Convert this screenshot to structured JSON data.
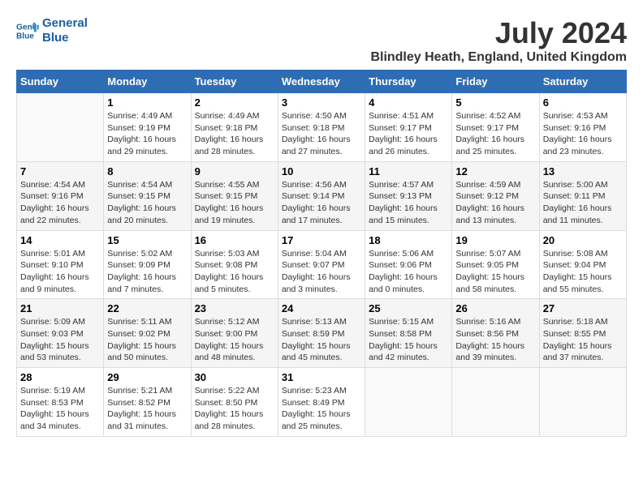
{
  "header": {
    "logo_line1": "General",
    "logo_line2": "Blue",
    "month_title": "July 2024",
    "location": "Blindley Heath, England, United Kingdom"
  },
  "weekdays": [
    "Sunday",
    "Monday",
    "Tuesday",
    "Wednesday",
    "Thursday",
    "Friday",
    "Saturday"
  ],
  "weeks": [
    [
      {
        "day": "",
        "info": ""
      },
      {
        "day": "1",
        "info": "Sunrise: 4:49 AM\nSunset: 9:19 PM\nDaylight: 16 hours\nand 29 minutes."
      },
      {
        "day": "2",
        "info": "Sunrise: 4:49 AM\nSunset: 9:18 PM\nDaylight: 16 hours\nand 28 minutes."
      },
      {
        "day": "3",
        "info": "Sunrise: 4:50 AM\nSunset: 9:18 PM\nDaylight: 16 hours\nand 27 minutes."
      },
      {
        "day": "4",
        "info": "Sunrise: 4:51 AM\nSunset: 9:17 PM\nDaylight: 16 hours\nand 26 minutes."
      },
      {
        "day": "5",
        "info": "Sunrise: 4:52 AM\nSunset: 9:17 PM\nDaylight: 16 hours\nand 25 minutes."
      },
      {
        "day": "6",
        "info": "Sunrise: 4:53 AM\nSunset: 9:16 PM\nDaylight: 16 hours\nand 23 minutes."
      }
    ],
    [
      {
        "day": "7",
        "info": "Sunrise: 4:54 AM\nSunset: 9:16 PM\nDaylight: 16 hours\nand 22 minutes."
      },
      {
        "day": "8",
        "info": "Sunrise: 4:54 AM\nSunset: 9:15 PM\nDaylight: 16 hours\nand 20 minutes."
      },
      {
        "day": "9",
        "info": "Sunrise: 4:55 AM\nSunset: 9:15 PM\nDaylight: 16 hours\nand 19 minutes."
      },
      {
        "day": "10",
        "info": "Sunrise: 4:56 AM\nSunset: 9:14 PM\nDaylight: 16 hours\nand 17 minutes."
      },
      {
        "day": "11",
        "info": "Sunrise: 4:57 AM\nSunset: 9:13 PM\nDaylight: 16 hours\nand 15 minutes."
      },
      {
        "day": "12",
        "info": "Sunrise: 4:59 AM\nSunset: 9:12 PM\nDaylight: 16 hours\nand 13 minutes."
      },
      {
        "day": "13",
        "info": "Sunrise: 5:00 AM\nSunset: 9:11 PM\nDaylight: 16 hours\nand 11 minutes."
      }
    ],
    [
      {
        "day": "14",
        "info": "Sunrise: 5:01 AM\nSunset: 9:10 PM\nDaylight: 16 hours\nand 9 minutes."
      },
      {
        "day": "15",
        "info": "Sunrise: 5:02 AM\nSunset: 9:09 PM\nDaylight: 16 hours\nand 7 minutes."
      },
      {
        "day": "16",
        "info": "Sunrise: 5:03 AM\nSunset: 9:08 PM\nDaylight: 16 hours\nand 5 minutes."
      },
      {
        "day": "17",
        "info": "Sunrise: 5:04 AM\nSunset: 9:07 PM\nDaylight: 16 hours\nand 3 minutes."
      },
      {
        "day": "18",
        "info": "Sunrise: 5:06 AM\nSunset: 9:06 PM\nDaylight: 16 hours\nand 0 minutes."
      },
      {
        "day": "19",
        "info": "Sunrise: 5:07 AM\nSunset: 9:05 PM\nDaylight: 15 hours\nand 58 minutes."
      },
      {
        "day": "20",
        "info": "Sunrise: 5:08 AM\nSunset: 9:04 PM\nDaylight: 15 hours\nand 55 minutes."
      }
    ],
    [
      {
        "day": "21",
        "info": "Sunrise: 5:09 AM\nSunset: 9:03 PM\nDaylight: 15 hours\nand 53 minutes."
      },
      {
        "day": "22",
        "info": "Sunrise: 5:11 AM\nSunset: 9:02 PM\nDaylight: 15 hours\nand 50 minutes."
      },
      {
        "day": "23",
        "info": "Sunrise: 5:12 AM\nSunset: 9:00 PM\nDaylight: 15 hours\nand 48 minutes."
      },
      {
        "day": "24",
        "info": "Sunrise: 5:13 AM\nSunset: 8:59 PM\nDaylight: 15 hours\nand 45 minutes."
      },
      {
        "day": "25",
        "info": "Sunrise: 5:15 AM\nSunset: 8:58 PM\nDaylight: 15 hours\nand 42 minutes."
      },
      {
        "day": "26",
        "info": "Sunrise: 5:16 AM\nSunset: 8:56 PM\nDaylight: 15 hours\nand 39 minutes."
      },
      {
        "day": "27",
        "info": "Sunrise: 5:18 AM\nSunset: 8:55 PM\nDaylight: 15 hours\nand 37 minutes."
      }
    ],
    [
      {
        "day": "28",
        "info": "Sunrise: 5:19 AM\nSunset: 8:53 PM\nDaylight: 15 hours\nand 34 minutes."
      },
      {
        "day": "29",
        "info": "Sunrise: 5:21 AM\nSunset: 8:52 PM\nDaylight: 15 hours\nand 31 minutes."
      },
      {
        "day": "30",
        "info": "Sunrise: 5:22 AM\nSunset: 8:50 PM\nDaylight: 15 hours\nand 28 minutes."
      },
      {
        "day": "31",
        "info": "Sunrise: 5:23 AM\nSunset: 8:49 PM\nDaylight: 15 hours\nand 25 minutes."
      },
      {
        "day": "",
        "info": ""
      },
      {
        "day": "",
        "info": ""
      },
      {
        "day": "",
        "info": ""
      }
    ]
  ]
}
